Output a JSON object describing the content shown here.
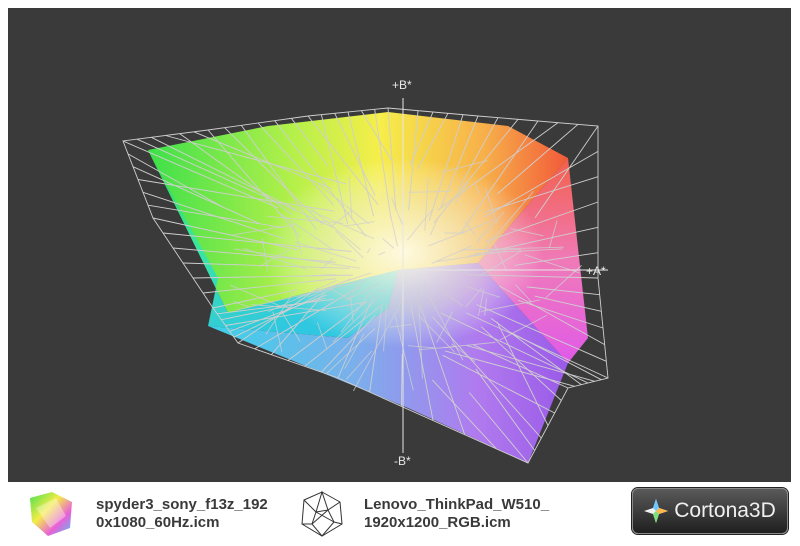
{
  "viewer": {
    "axis_labels": {
      "b_plus": "+B*",
      "b_minus": "-B*",
      "a_plus": "+A*"
    },
    "background_color": "#3a3a3a",
    "wireframe_color": "#c8c8c8"
  },
  "legend": {
    "items": [
      {
        "label_line1": "spyder3_sony_f13z_192",
        "label_line2": "0x1080_60Hz.icm",
        "icon": "solid-gamut-icon"
      },
      {
        "label_line1": "Lenovo_ThinkPad_W510_",
        "label_line2": "1920x1200_RGB.icm",
        "icon": "wireframe-gamut-icon"
      }
    ]
  },
  "brand": {
    "name": "Cortona3D",
    "icon": "cortona-star-icon"
  }
}
